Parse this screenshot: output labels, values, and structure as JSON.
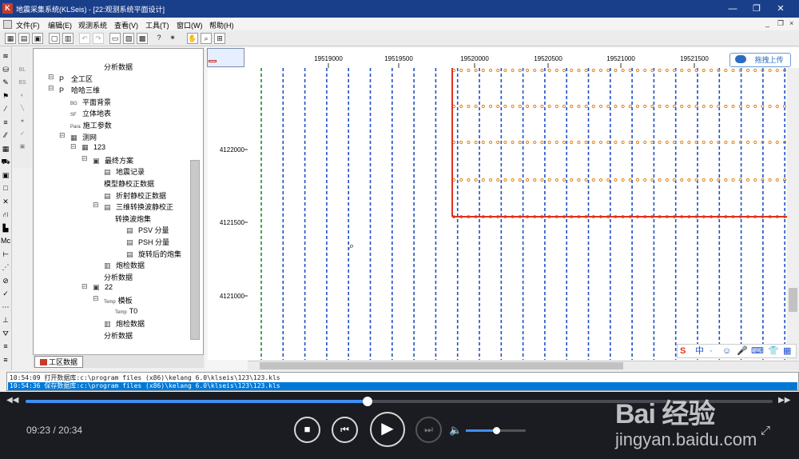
{
  "window": {
    "title": "地震采集系统(KLSeis) - [22:观测系统平面设计]",
    "logo": "K",
    "minimize": "—",
    "restore": "❐",
    "close": "✕"
  },
  "menu": {
    "items": [
      "文件(F)",
      "编辑(E)",
      "观测系统",
      "查看(V)",
      "工具(T)",
      "窗口(W)",
      "帮助(H)"
    ],
    "right_controls": [
      "_",
      "❐",
      "×"
    ]
  },
  "toolbar": {
    "buttons": [
      "▦",
      "▤",
      "▣",
      "▢",
      "▥",
      "↶",
      "↷",
      "▭",
      "▨",
      "▩",
      "?",
      "✶",
      "✋",
      "⌕",
      "⊞"
    ]
  },
  "left_tools": [
    "≋",
    "⛁",
    "✎",
    "⚑",
    "⁄",
    "≡",
    "⁄⁄",
    "▦",
    "⛟",
    "▣",
    "□",
    "✕",
    "⛙",
    "▙",
    "Mc",
    "⊢",
    "⋰",
    "⊘",
    "✓",
    "⋯",
    "⊥",
    "⛛",
    "≡",
    "≡"
  ],
  "sec_tools": [
    "BL",
    "BS",
    "◐",
    "╲",
    "●",
    "✓",
    "▣"
  ],
  "tree": {
    "nodes": [
      {
        "label": "分析数据",
        "icon": ""
      },
      {
        "label": "全工区",
        "icon": "P"
      },
      {
        "label": "哈哈三维",
        "icon": "P"
      },
      {
        "label": "平面背景",
        "icon": "BG"
      },
      {
        "label": "立体地表",
        "icon": "SF"
      },
      {
        "label": "施工参数",
        "icon": "Para"
      },
      {
        "label": "测网",
        "icon": "▦"
      },
      {
        "label": "123",
        "icon": "▦"
      },
      {
        "label": "最终方案",
        "icon": "▣"
      },
      {
        "label": "地震记录",
        "icon": "▤"
      },
      {
        "label": "模型静校正数据",
        "icon": ""
      },
      {
        "label": "折射静校正数据",
        "icon": "▤"
      },
      {
        "label": "三维转换波静校正",
        "icon": "▤"
      },
      {
        "label": "转换波炮集",
        "icon": ""
      },
      {
        "label": "PSV 分量",
        "icon": "▤"
      },
      {
        "label": "PSH 分量",
        "icon": "▤"
      },
      {
        "label": "旋转后的炮集",
        "icon": "▤"
      },
      {
        "label": "炮检数据",
        "icon": "▥"
      },
      {
        "label": "分析数据",
        "icon": ""
      },
      {
        "label": "22",
        "icon": "▣"
      },
      {
        "label": "模板",
        "icon": "Temp"
      },
      {
        "label": "T0",
        "icon": "Temp"
      },
      {
        "label": "炮检数据",
        "icon": "▥"
      },
      {
        "label": "分析数据",
        "icon": ""
      }
    ],
    "tab": "工区数据"
  },
  "map": {
    "x_ticks": [
      "19519000",
      "19519500",
      "19520000",
      "19520500",
      "19521000",
      "19521500"
    ],
    "y_ticks": [
      "4122000",
      "4121500",
      "4121000"
    ],
    "colors": {
      "receiver": "#1f4fc8",
      "source": "#e0851a",
      "boundary": "#e03020",
      "edge": "#1a8a2a"
    }
  },
  "upload_button": "拖拽上传",
  "status": {
    "line1": "10:54:09 打开数据库:c:\\program files (x86)\\kelang 6.0\\klseis\\123\\123.kls",
    "line2": "10:54:36 保存数据库:c:\\program files (x86)\\kelang 6.0\\klseis\\123\\123.kls"
  },
  "ime": [
    "S",
    "中",
    "·",
    "☺",
    "🎤",
    "⌨",
    "👕",
    "▦"
  ],
  "player": {
    "time": "09:23 / 20:34",
    "progress": 0.458,
    "volume": 0.5,
    "controls": {
      "prev_skip": "◀◀",
      "next_skip": "▶▶",
      "stop": "■",
      "prev": "⏮",
      "play": "▶",
      "next": "⏭",
      "volume": "🔈",
      "fullscreen": "⤢"
    }
  },
  "watermark": {
    "brand": "Bai 经验",
    "url": "jingyan.baidu.com"
  }
}
